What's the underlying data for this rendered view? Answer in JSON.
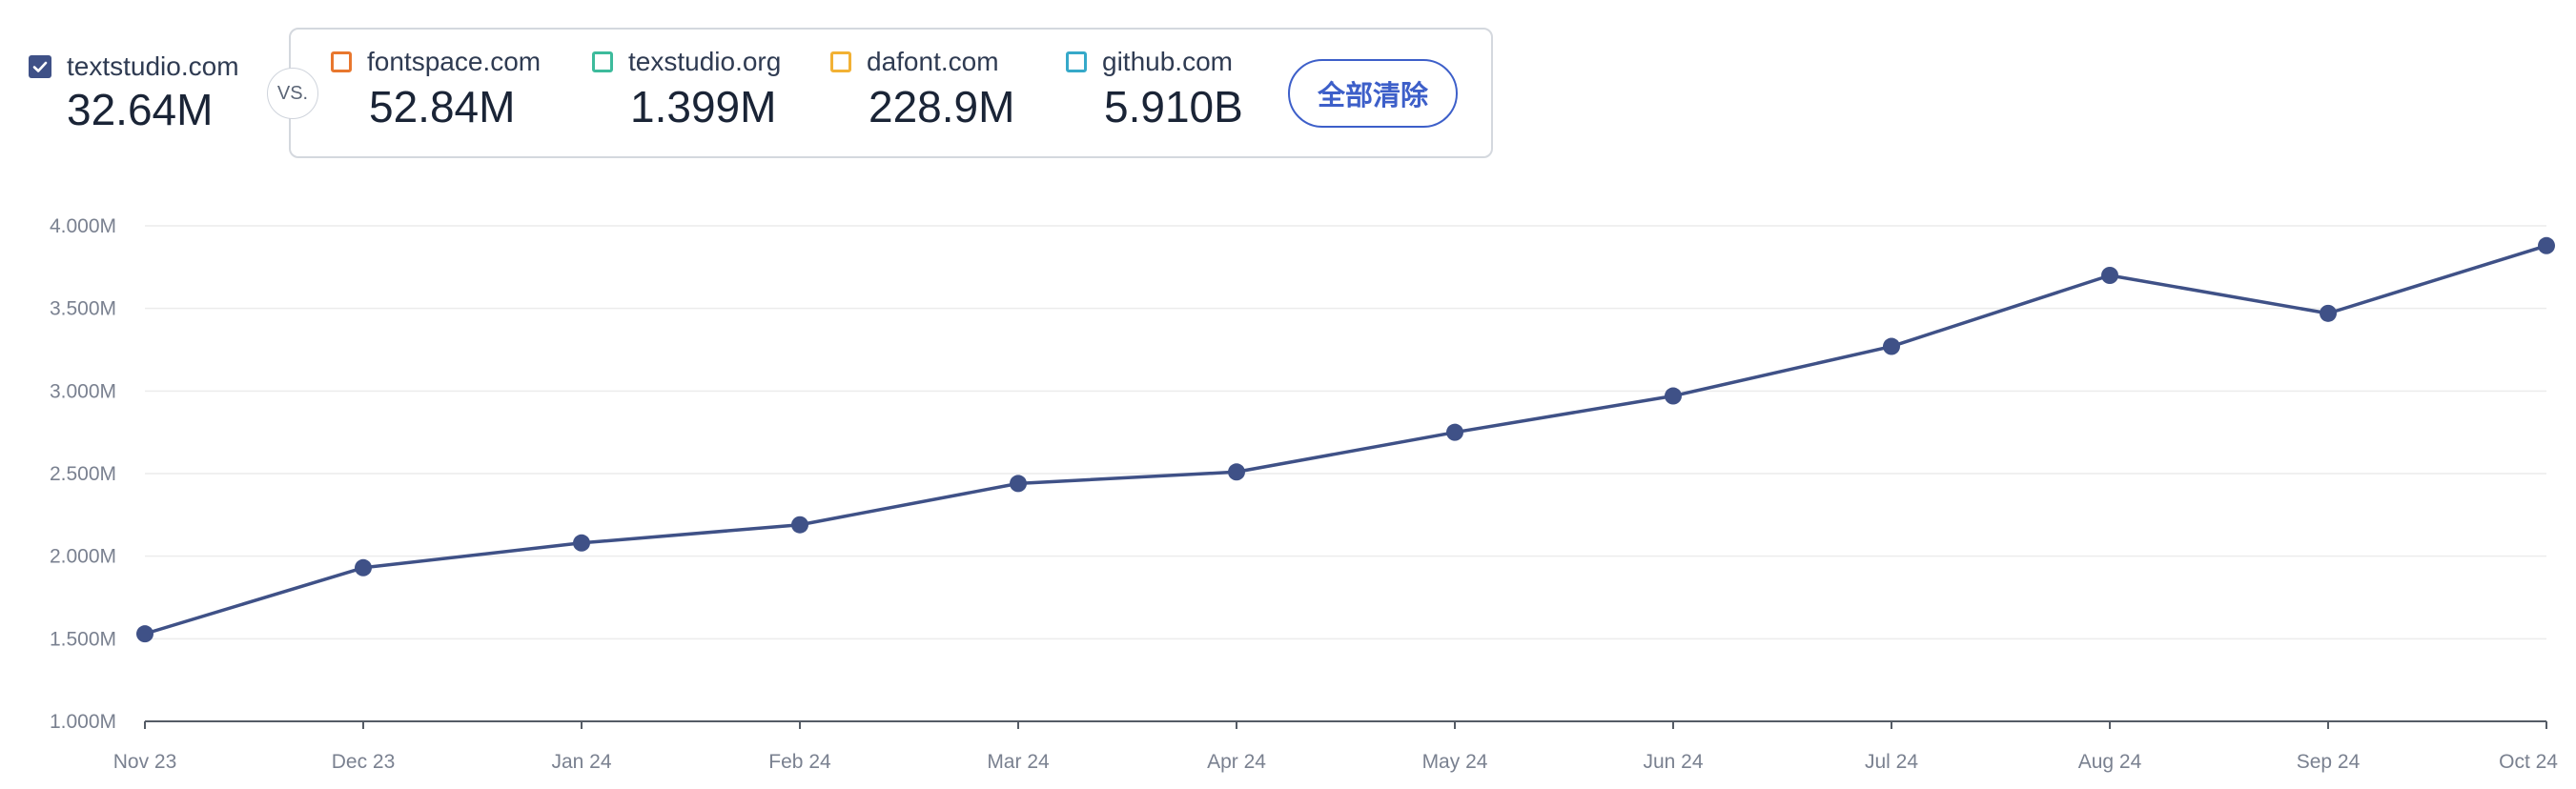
{
  "primary": {
    "name": "textstudio.com",
    "value": "32.64M",
    "checked": true,
    "color": "#3f5187"
  },
  "vs_label": "VS.",
  "competitors": [
    {
      "name": "fontspace.com",
      "value": "52.84M",
      "color": "#e8772e"
    },
    {
      "name": "texstudio.org",
      "value": "1.399M",
      "color": "#3dbb9c"
    },
    {
      "name": "dafont.com",
      "value": "228.9M",
      "color": "#f2b134"
    },
    {
      "name": "github.com",
      "value": "5.910B",
      "color": "#36a9c9"
    }
  ],
  "clear_all_label": "全部清除",
  "chart_data": {
    "type": "line",
    "categories": [
      "Nov 23",
      "Dec 23",
      "Jan 24",
      "Feb 24",
      "Mar 24",
      "Apr 24",
      "May 24",
      "Jun 24",
      "Jul 24",
      "Aug 24",
      "Sep 24",
      "Oct 24"
    ],
    "series": [
      {
        "name": "textstudio.com",
        "color": "#3f5187",
        "values": [
          1.53,
          1.93,
          2.08,
          2.19,
          2.44,
          2.51,
          2.75,
          2.97,
          3.27,
          3.7,
          3.47,
          3.88
        ]
      }
    ],
    "y_ticks": [
      "1.000M",
      "1.500M",
      "2.000M",
      "2.500M",
      "3.000M",
      "3.500M",
      "4.000M"
    ],
    "ylim": [
      1.0,
      4.0
    ],
    "unit": "M",
    "grid": true
  }
}
